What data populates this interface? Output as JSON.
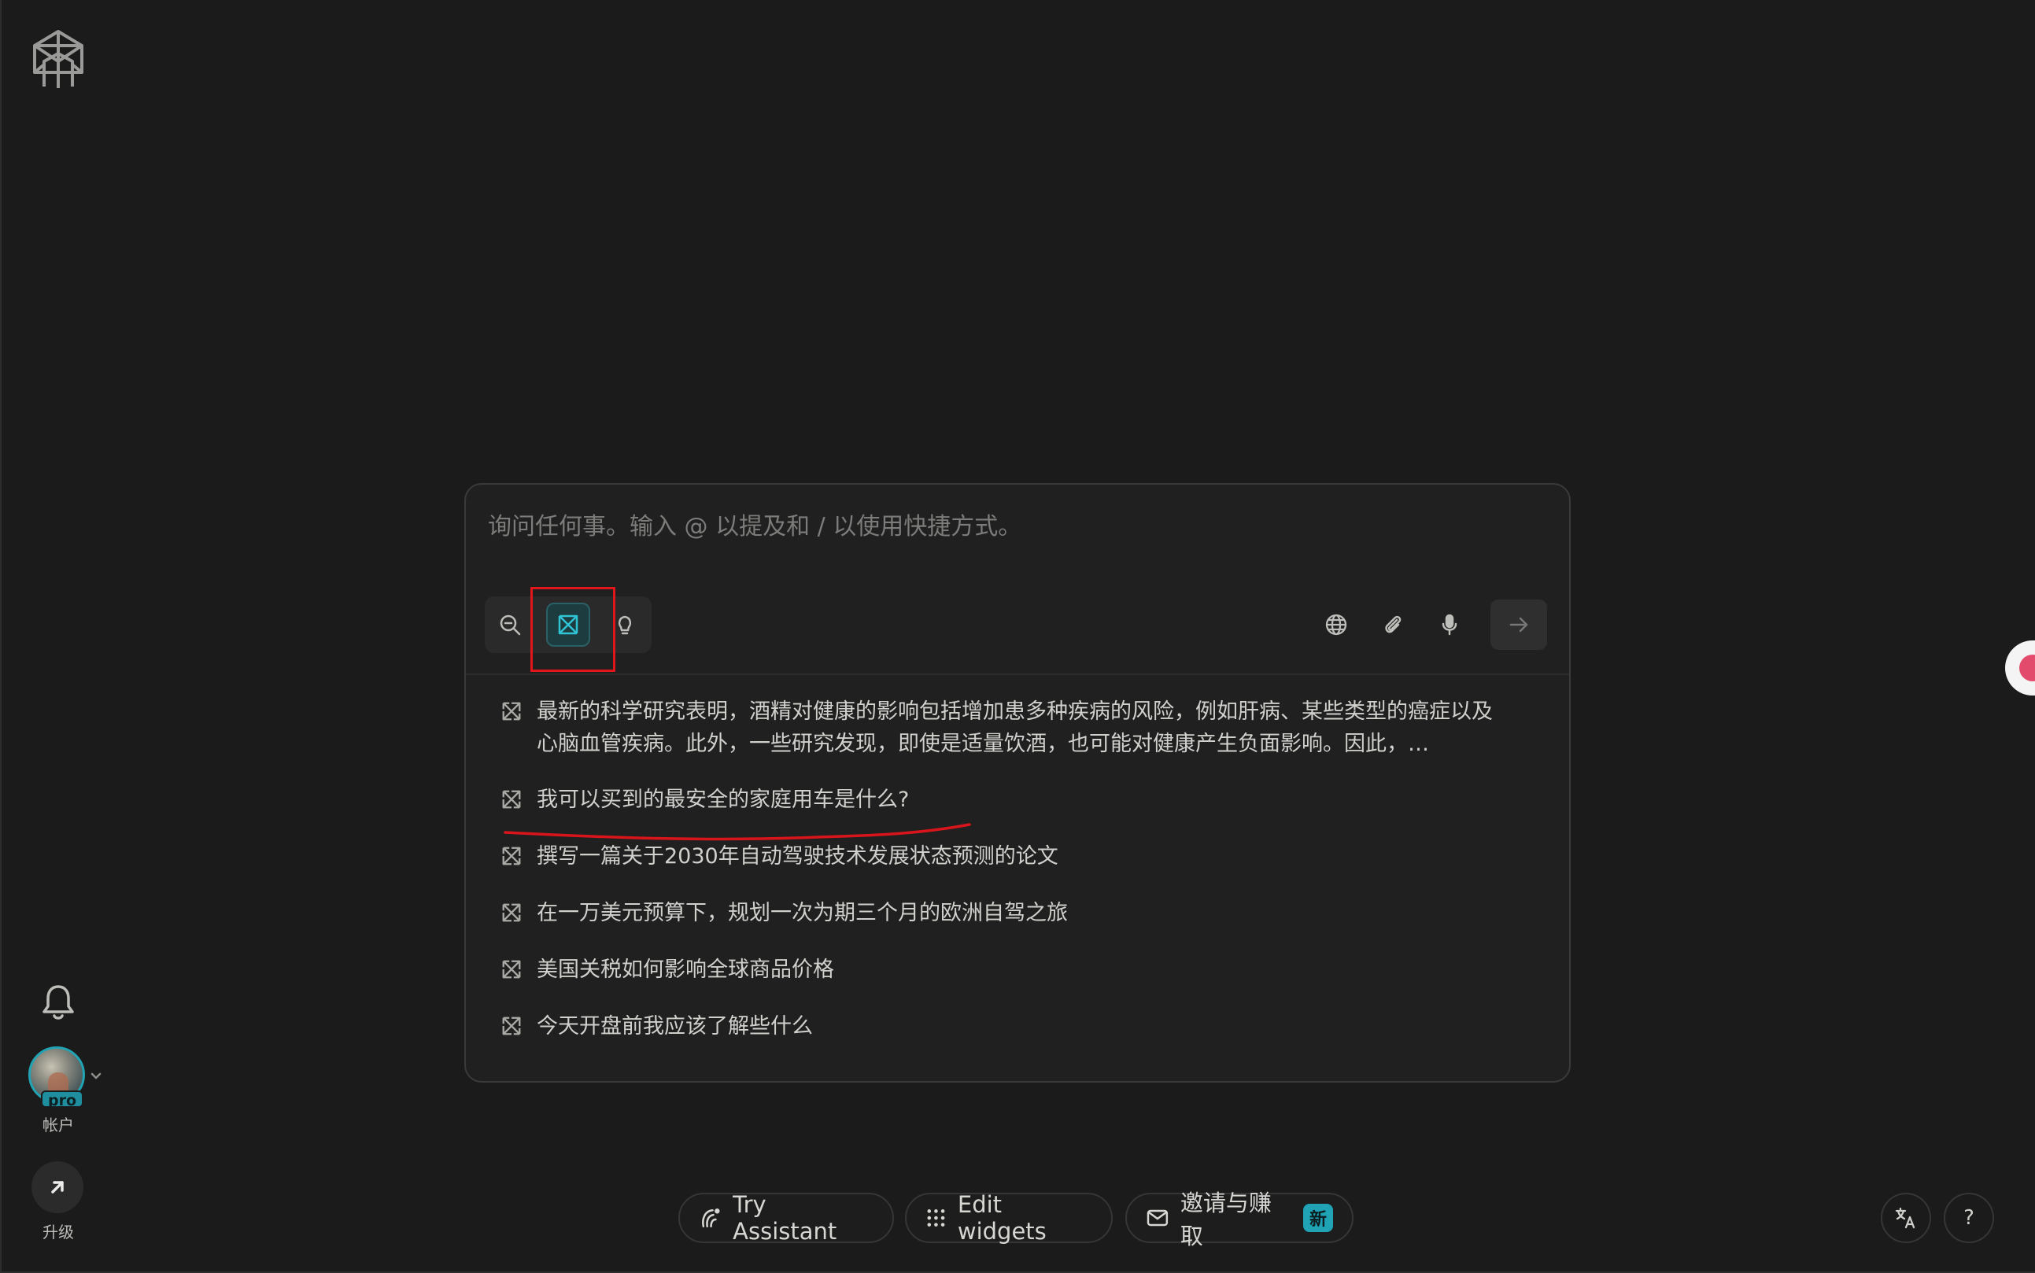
{
  "sidebar": {
    "logo_icon": "perplexity-logo-icon",
    "notifications_icon": "bell-icon",
    "account": {
      "badge": "pro",
      "label": "帐户"
    },
    "upgrade": {
      "icon": "arrow-up-right-icon",
      "label": "升级"
    }
  },
  "ask": {
    "placeholder": "询问任何事。输入 @ 以提及和 / 以使用快捷方式。",
    "modes": [
      "search-icon",
      "research-icon",
      "lightbulb-icon"
    ],
    "active_mode": "research",
    "tools": [
      "globe-icon",
      "paperclip-icon",
      "microphone-icon"
    ],
    "submit_icon": "arrow-right-icon"
  },
  "suggestions": [
    {
      "text": "最新的科学研究表明，酒精对健康的影响包括增加患多种疾病的风险，例如肝病、某些类型的癌症以及心脑血管疾病。此外，一些研究发现，即使是适量饮酒，也可能对健康产生负面影响。因此，…"
    },
    {
      "text": "我可以买到的最安全的家庭用车是什么?"
    },
    {
      "text": "撰写一篇关于2030年自动驾驶技术发展状态预测的论文"
    },
    {
      "text": "在一万美元预算下，规划一次为期三个月的欧洲自驾之旅"
    },
    {
      "text": "美国关税如何影响全球商品价格"
    },
    {
      "text": "今天开盘前我应该了解些什么"
    }
  ],
  "bottom": {
    "assistant": "Try Assistant",
    "widgets": "Edit widgets",
    "invite": "邀请与赚取",
    "new_badge": "新",
    "translate_icon": "translate-icon",
    "help": "?"
  },
  "colors": {
    "background": "#1b1b1b",
    "accent": "#21a3b3",
    "highlight": "#e0161b",
    "annotation": "#d8151b"
  }
}
